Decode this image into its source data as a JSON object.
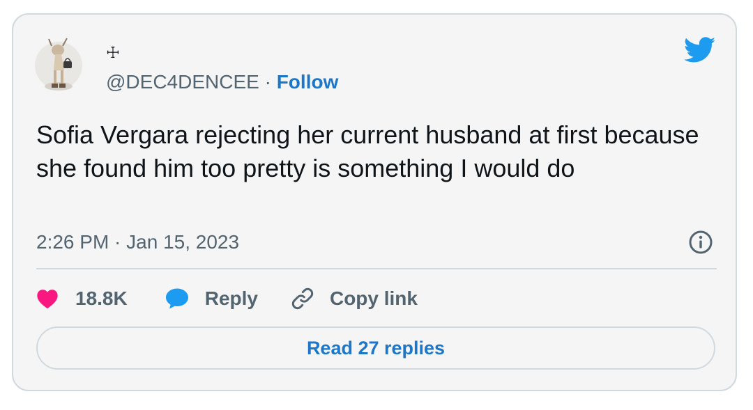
{
  "author": {
    "display_name": "☩",
    "handle": "@DEC4DENCEE",
    "separator": " · ",
    "follow_label": "Follow"
  },
  "tweet": {
    "text": "Sofia Vergara rejecting her current husband at first because she found him too pretty is something I would do",
    "timestamp": "2:26 PM · Jan 15, 2023"
  },
  "actions": {
    "likes": "18.8K",
    "reply_label": "Reply",
    "copy_link_label": "Copy link"
  },
  "read_replies_label": "Read 27 replies",
  "icons": {
    "brand": "twitter-bird-icon",
    "info": "info-icon",
    "like": "heart-icon",
    "reply": "speech-bubble-icon",
    "copy": "link-icon"
  },
  "colors": {
    "brand_blue": "#1d9bf0",
    "link_blue": "#1d77c9",
    "like_pink": "#f91880",
    "muted_text": "#536471",
    "text": "#0f1419",
    "border": "#cfd9de",
    "card_bg": "#f5f5f5"
  }
}
